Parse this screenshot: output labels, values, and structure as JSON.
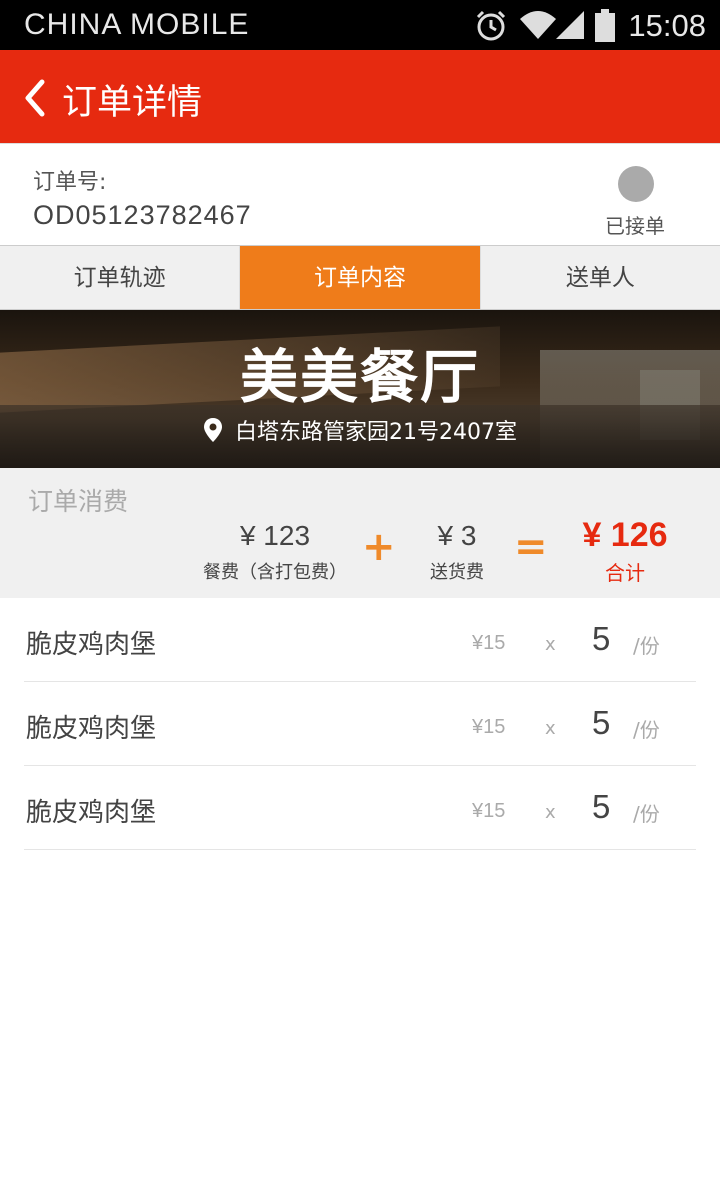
{
  "status_bar": {
    "carrier": "CHINA  MOBILE",
    "time": "15:08",
    "icons": [
      "alarm-icon",
      "wifi-icon",
      "signal-icon",
      "battery-icon"
    ]
  },
  "header": {
    "title": "订单详情",
    "background": "#e62a10"
  },
  "order": {
    "label": "订单号:",
    "number": "OD05123782467",
    "status": "已接单"
  },
  "tabs": [
    {
      "label": "订单轨迹",
      "active": false
    },
    {
      "label": "订单内容",
      "active": true
    },
    {
      "label": "送单人",
      "active": false
    }
  ],
  "restaurant": {
    "name": "美美餐厅",
    "address": "白塔东路管家园21号2407室"
  },
  "consumption": {
    "heading": "订单消费",
    "food_amount": "¥  123",
    "food_caption": "餐费（含打包费）",
    "plus": "+",
    "delivery_amount": "¥ 3",
    "delivery_caption": "送货费",
    "equals": "=",
    "total_amount": "¥ 126",
    "total_caption": "合计",
    "accent": "#ef7c1a",
    "total_color": "#e62a10"
  },
  "items": [
    {
      "name": "脆皮鸡肉堡",
      "price": "¥15",
      "times": "x",
      "qty": "5",
      "unit": "/份"
    },
    {
      "name": "脆皮鸡肉堡",
      "price": "¥15",
      "times": "x",
      "qty": "5",
      "unit": "/份"
    },
    {
      "name": "脆皮鸡肉堡",
      "price": "¥15",
      "times": "x",
      "qty": "5",
      "unit": "/份"
    }
  ]
}
